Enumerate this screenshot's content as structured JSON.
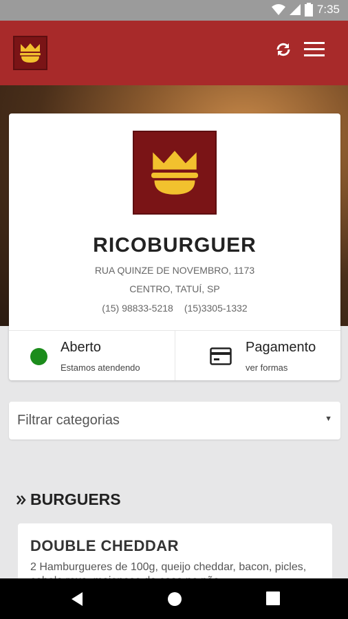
{
  "status_bar": {
    "time": "7:35",
    "icons": [
      "wifi-icon",
      "signal-icon",
      "battery-icon"
    ]
  },
  "app_bar": {
    "logo": "crown-burger-logo",
    "actions": [
      "refresh-icon",
      "menu-icon"
    ],
    "color": "#a82a2a"
  },
  "shop": {
    "name": "RICOBURGUER",
    "address_line1": "RUA QUINZE DE NOVEMBRO, 1173",
    "address_line2": "CENTRO, TATUÍ, SP",
    "phone1": "(15) 98833-5218",
    "phone2": "(15)3305-1332"
  },
  "status": {
    "title": "Aberto",
    "subtitle": "Estamos atendendo",
    "color": "#1c8c1c"
  },
  "payment": {
    "title": "Pagamento",
    "subtitle": "ver formas"
  },
  "filter": {
    "label": "Filtrar categorias"
  },
  "section": {
    "title": "BURGUERS"
  },
  "product": {
    "name": "DOUBLE CHEDDAR",
    "description": "2 Hamburgueres de 100g, queijo cheddar, bacon, picles, cebola roxa, maionese da casa no pão"
  }
}
